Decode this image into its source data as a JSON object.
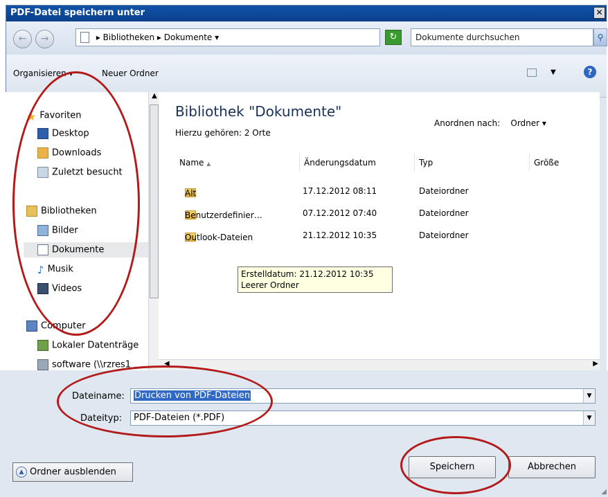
{
  "window": {
    "title": "PDF-Datei speichern unter",
    "close_glyph": "✕"
  },
  "address": {
    "crumbs": [
      "Bibliotheken",
      "Dokumente"
    ],
    "search_placeholder": "Dokumente durchsuchen"
  },
  "toolbar": {
    "organize": "Organisieren",
    "new_folder": "Neuer Ordner",
    "help": "?"
  },
  "nav": {
    "items": [
      {
        "label": "Favoriten",
        "icon": "star-icon"
      },
      {
        "label": "Desktop",
        "icon": "desktop-icon"
      },
      {
        "label": "Downloads",
        "icon": "downloads-icon"
      },
      {
        "label": "Zuletzt besucht",
        "icon": "recent-icon"
      },
      {
        "label": "Bibliotheken",
        "icon": "libraries-icon"
      },
      {
        "label": "Bilder",
        "icon": "pictures-icon"
      },
      {
        "label": "Dokumente",
        "icon": "documents-icon"
      },
      {
        "label": "Musik",
        "icon": "music-icon"
      },
      {
        "label": "Videos",
        "icon": "videos-icon"
      },
      {
        "label": "Computer",
        "icon": "computer-icon"
      },
      {
        "label": "Lokaler Datenträge",
        "icon": "drive-icon"
      },
      {
        "label": "software (\\\\rzres1",
        "icon": "network-drive-icon"
      }
    ],
    "selected": "Dokumente"
  },
  "library": {
    "title": "Bibliothek \"Dokumente\"",
    "subtitle": "Hierzu gehören: 2 Orte",
    "arrange_label": "Anordnen nach:",
    "arrange_value": "Ordner"
  },
  "columns": {
    "name": "Name",
    "date": "Änderungsdatum",
    "type": "Typ",
    "size": "Größe"
  },
  "files": [
    {
      "name": "Alt",
      "date": "17.12.2012 08:11",
      "type": "Dateiordner"
    },
    {
      "name": "Benutzerdefinier…",
      "date": "07.12.2012 07:40",
      "type": "Dateiordner"
    },
    {
      "name": "Outlook-Dateien",
      "date": "21.12.2012 10:35",
      "type": "Dateiordner"
    }
  ],
  "tooltip": {
    "line1": "Erstelldatum: 21.12.2012 10:35",
    "line2": "Leerer Ordner"
  },
  "form": {
    "filename_label": "Dateiname:",
    "filename_value": "Drucken von PDF-Dateien",
    "filetype_label": "Dateityp:",
    "filetype_value": "PDF-Dateien (*.PDF)"
  },
  "buttons": {
    "hide_folders": "Ordner ausblenden",
    "save": "Speichern",
    "cancel": "Abbrechen"
  },
  "annotation_color": "#b31b1b"
}
